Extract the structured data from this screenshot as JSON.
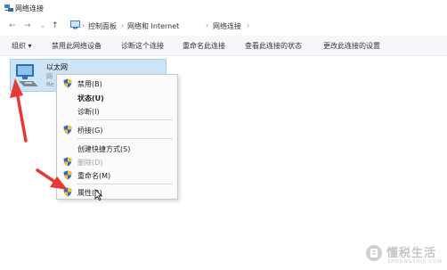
{
  "window": {
    "title": "网络连接"
  },
  "address_bar": {
    "back_icon": "back-arrow-icon",
    "forward_icon": "forward-arrow-icon",
    "recent_icon": "chevron-down-icon",
    "up_icon": "up-arrow-icon",
    "breadcrumbs": [
      "控制面板",
      "网络和 Internet",
      "网络连接"
    ]
  },
  "toolbar": {
    "items": [
      "组织 ▾",
      "禁用此网络设备",
      "诊断这个连接",
      "重命名此连接",
      "查看此连接的状态",
      "更改此连接的设置"
    ]
  },
  "connection": {
    "name": "以太网",
    "sub_lines": [
      "网",
      "Re"
    ],
    "icon": "ethernet-adapter-icon"
  },
  "context_menu": {
    "items": [
      {
        "label": "禁用(B)",
        "shield": true,
        "bold": false,
        "disabled": false
      },
      {
        "label": "状态(U)",
        "shield": false,
        "bold": true,
        "disabled": false
      },
      {
        "label": "诊断(I)",
        "shield": false,
        "bold": false,
        "disabled": false
      },
      {
        "label": "桥接(G)",
        "shield": true,
        "bold": false,
        "disabled": false
      },
      {
        "label": "创建快捷方式(S)",
        "shield": false,
        "bold": false,
        "disabled": false
      },
      {
        "label": "删除(D)",
        "shield": true,
        "bold": false,
        "disabled": true
      },
      {
        "label": "重命名(M)",
        "shield": true,
        "bold": false,
        "disabled": false
      },
      {
        "label": "属性(R)",
        "shield": true,
        "bold": false,
        "disabled": false
      }
    ]
  },
  "annotations": {
    "arrow_color": "#e53935"
  },
  "watermark": {
    "title": "懂税生活",
    "subtitle": "SHDONGSHUI.COM"
  },
  "colors": {
    "selection": "#cde4f7",
    "toolbar": "#f5f7fa",
    "menu_bg": "#fbfbfb"
  }
}
